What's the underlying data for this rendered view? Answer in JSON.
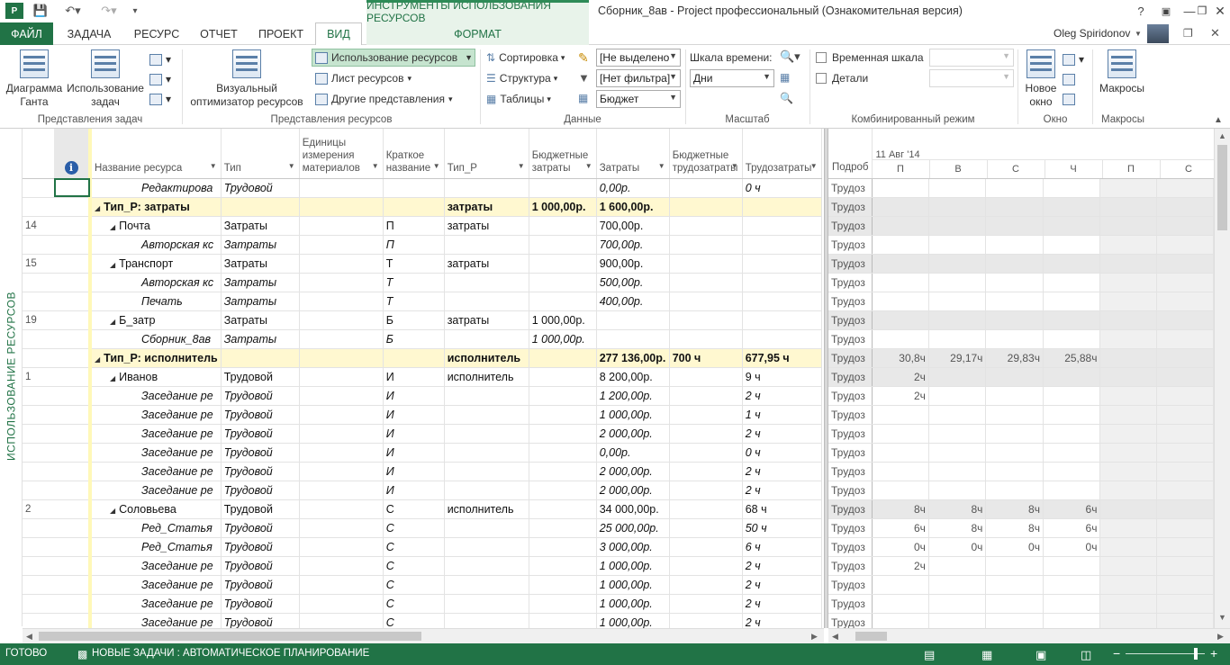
{
  "app": {
    "window_title": "Сборник_8ав - Project профессиональный (Ознакомительная версия)",
    "context_group": "ИНСТРУМЕНТЫ ИСПОЛЬЗОВАНИЯ РЕСУРСОВ",
    "user": "Oleg Spiridonov",
    "help": "?"
  },
  "tabs": [
    "ФАЙЛ",
    "ЗАДАЧА",
    "РЕСУРС",
    "ОТЧЕТ",
    "ПРОЕКТ",
    "ВИД",
    "ФОРМАТ"
  ],
  "ribbon": {
    "gantt": "Диаграмма Ганта",
    "task_usage": "Использование задач",
    "visual_optimizer": "Визуальный оптимизатор ресурсов",
    "resource_usage": "Использование ресурсов",
    "resource_sheet": "Лист ресурсов",
    "other_views": "Другие представления",
    "sort": "Сортировка",
    "outline": "Структура",
    "tables": "Таблицы",
    "highlight": "[Не выделено",
    "filter": "[Нет фильтра]",
    "group": "Бюджет",
    "timescale_label": "Шкала времени:",
    "timescale_value": "Дни",
    "timeline_chk": "Временная шкала",
    "details_chk": "Детали",
    "new_window": "Новое окно",
    "macros": "Макросы",
    "groups": {
      "task_views": "Представления задач",
      "resource_views": "Представления ресурсов",
      "data": "Данные",
      "zoom": "Масштаб",
      "split": "Комбинированный режим",
      "window": "Окно",
      "macros": "Макросы"
    }
  },
  "sidebar_label": "ИСПОЛЬЗОВАНИЕ РЕСУРСОВ",
  "columns": [
    "Название ресурса",
    "Тип",
    "Единицы измерения материалов",
    "Краткое название",
    "Тип_Р",
    "Бюджетные затраты",
    "Затраты",
    "Бюджетные трудозатраты",
    "Трудозатраты"
  ],
  "rows": [
    {
      "n": "",
      "name": "Редактирова",
      "lvl": 2,
      "type": "Трудовой",
      "unit": "",
      "short": "",
      "tp": "",
      "bc": "",
      "cost": "0,00р.",
      "bw": "",
      "work": "0 ч",
      "it": true,
      "grp": false
    },
    {
      "n": "",
      "name": "Тип_Р: затраты",
      "lvl": 0,
      "type": "",
      "unit": "",
      "short": "",
      "tp": "затраты",
      "bc": "1 000,00р.",
      "cost": "1 600,00р.",
      "bw": "",
      "work": "",
      "it": false,
      "grp": true
    },
    {
      "n": "14",
      "name": "Почта",
      "lvl": 1,
      "type": "Затраты",
      "unit": "",
      "short": "П",
      "tp": "затраты",
      "bc": "",
      "cost": "700,00р.",
      "bw": "",
      "work": "",
      "it": false,
      "grp": false
    },
    {
      "n": "",
      "name": "Авторская кс",
      "lvl": 2,
      "type": "Затраты",
      "unit": "",
      "short": "П",
      "tp": "",
      "bc": "",
      "cost": "700,00р.",
      "bw": "",
      "work": "",
      "it": true,
      "grp": false
    },
    {
      "n": "15",
      "name": "Транспорт",
      "lvl": 1,
      "type": "Затраты",
      "unit": "",
      "short": "Т",
      "tp": "затраты",
      "bc": "",
      "cost": "900,00р.",
      "bw": "",
      "work": "",
      "it": false,
      "grp": false
    },
    {
      "n": "",
      "name": "Авторская кс",
      "lvl": 2,
      "type": "Затраты",
      "unit": "",
      "short": "Т",
      "tp": "",
      "bc": "",
      "cost": "500,00р.",
      "bw": "",
      "work": "",
      "it": true,
      "grp": false
    },
    {
      "n": "",
      "name": "Печать",
      "lvl": 2,
      "type": "Затраты",
      "unit": "",
      "short": "Т",
      "tp": "",
      "bc": "",
      "cost": "400,00р.",
      "bw": "",
      "work": "",
      "it": true,
      "grp": false
    },
    {
      "n": "19",
      "name": "Б_затр",
      "lvl": 1,
      "type": "Затраты",
      "unit": "",
      "short": "Б",
      "tp": "затраты",
      "bc": "1 000,00р.",
      "cost": "",
      "bw": "",
      "work": "",
      "it": false,
      "grp": false
    },
    {
      "n": "",
      "name": "Сборник_8ав",
      "lvl": 2,
      "type": "Затраты",
      "unit": "",
      "short": "Б",
      "tp": "",
      "bc": "1 000,00р.",
      "cost": "",
      "bw": "",
      "work": "",
      "it": true,
      "grp": false
    },
    {
      "n": "",
      "name": "Тип_Р: исполнитель",
      "lvl": 0,
      "type": "",
      "unit": "",
      "short": "",
      "tp": "исполнитель",
      "bc": "",
      "cost": "277 136,00р.",
      "bw": "700 ч",
      "work": "677,95 ч",
      "it": false,
      "grp": true
    },
    {
      "n": "1",
      "name": "Иванов",
      "lvl": 1,
      "type": "Трудовой",
      "unit": "",
      "short": "И",
      "tp": "исполнитель",
      "bc": "",
      "cost": "8 200,00р.",
      "bw": "",
      "work": "9 ч",
      "it": false,
      "grp": false
    },
    {
      "n": "",
      "name": "Заседание ре",
      "lvl": 2,
      "type": "Трудовой",
      "unit": "",
      "short": "И",
      "tp": "",
      "bc": "",
      "cost": "1 200,00р.",
      "bw": "",
      "work": "2 ч",
      "it": true,
      "grp": false
    },
    {
      "n": "",
      "name": "Заседание ре",
      "lvl": 2,
      "type": "Трудовой",
      "unit": "",
      "short": "И",
      "tp": "",
      "bc": "",
      "cost": "1 000,00р.",
      "bw": "",
      "work": "1 ч",
      "it": true,
      "grp": false
    },
    {
      "n": "",
      "name": "Заседание ре",
      "lvl": 2,
      "type": "Трудовой",
      "unit": "",
      "short": "И",
      "tp": "",
      "bc": "",
      "cost": "2 000,00р.",
      "bw": "",
      "work": "2 ч",
      "it": true,
      "grp": false
    },
    {
      "n": "",
      "name": "Заседание ре",
      "lvl": 2,
      "type": "Трудовой",
      "unit": "",
      "short": "И",
      "tp": "",
      "bc": "",
      "cost": "0,00р.",
      "bw": "",
      "work": "0 ч",
      "it": true,
      "grp": false
    },
    {
      "n": "",
      "name": "Заседание ре",
      "lvl": 2,
      "type": "Трудовой",
      "unit": "",
      "short": "И",
      "tp": "",
      "bc": "",
      "cost": "2 000,00р.",
      "bw": "",
      "work": "2 ч",
      "it": true,
      "grp": false
    },
    {
      "n": "",
      "name": "Заседание ре",
      "lvl": 2,
      "type": "Трудовой",
      "unit": "",
      "short": "И",
      "tp": "",
      "bc": "",
      "cost": "2 000,00р.",
      "bw": "",
      "work": "2 ч",
      "it": true,
      "grp": false
    },
    {
      "n": "2",
      "name": "Соловьева",
      "lvl": 1,
      "type": "Трудовой",
      "unit": "",
      "short": "С",
      "tp": "исполнитель",
      "bc": "",
      "cost": "34 000,00р.",
      "bw": "",
      "work": "68 ч",
      "it": false,
      "grp": false
    },
    {
      "n": "",
      "name": "Ред_Статья",
      "lvl": 2,
      "type": "Трудовой",
      "unit": "",
      "short": "С",
      "tp": "",
      "bc": "",
      "cost": "25 000,00р.",
      "bw": "",
      "work": "50 ч",
      "it": true,
      "grp": false
    },
    {
      "n": "",
      "name": "Ред_Статья",
      "lvl": 2,
      "type": "Трудовой",
      "unit": "",
      "short": "С",
      "tp": "",
      "bc": "",
      "cost": "3 000,00р.",
      "bw": "",
      "work": "6 ч",
      "it": true,
      "grp": false
    },
    {
      "n": "",
      "name": "Заседание ре",
      "lvl": 2,
      "type": "Трудовой",
      "unit": "",
      "short": "С",
      "tp": "",
      "bc": "",
      "cost": "1 000,00р.",
      "bw": "",
      "work": "2 ч",
      "it": true,
      "grp": false
    },
    {
      "n": "",
      "name": "Заседание ре",
      "lvl": 2,
      "type": "Трудовой",
      "unit": "",
      "short": "С",
      "tp": "",
      "bc": "",
      "cost": "1 000,00р.",
      "bw": "",
      "work": "2 ч",
      "it": true,
      "grp": false
    },
    {
      "n": "",
      "name": "Заседание ре",
      "lvl": 2,
      "type": "Трудовой",
      "unit": "",
      "short": "С",
      "tp": "",
      "bc": "",
      "cost": "1 000,00р.",
      "bw": "",
      "work": "2 ч",
      "it": true,
      "grp": false
    },
    {
      "n": "",
      "name": "Заседание ре",
      "lvl": 2,
      "type": "Трудовой",
      "unit": "",
      "short": "С",
      "tp": "",
      "bc": "",
      "cost": "1 000,00р.",
      "bw": "",
      "work": "2 ч",
      "it": true,
      "grp": false
    }
  ],
  "timeline": {
    "details_header": "Подроб",
    "week_label": "11 Авг '14",
    "days": [
      "П",
      "В",
      "С",
      "Ч",
      "П",
      "С"
    ],
    "detail_label": "Трудоз",
    "rows": [
      {
        "v": [
          "",
          "",
          "",
          "",
          "",
          ""
        ],
        "shade": false
      },
      {
        "v": [
          "",
          "",
          "",
          "",
          "",
          ""
        ],
        "shade": true
      },
      {
        "v": [
          "",
          "",
          "",
          "",
          "",
          ""
        ],
        "shade": true
      },
      {
        "v": [
          "",
          "",
          "",
          "",
          "",
          ""
        ],
        "shade": false
      },
      {
        "v": [
          "",
          "",
          "",
          "",
          "",
          ""
        ],
        "shade": true
      },
      {
        "v": [
          "",
          "",
          "",
          "",
          "",
          ""
        ],
        "shade": false
      },
      {
        "v": [
          "",
          "",
          "",
          "",
          "",
          ""
        ],
        "shade": false
      },
      {
        "v": [
          "",
          "",
          "",
          "",
          "",
          ""
        ],
        "shade": true
      },
      {
        "v": [
          "",
          "",
          "",
          "",
          "",
          ""
        ],
        "shade": false
      },
      {
        "v": [
          "30,8ч",
          "29,17ч",
          "29,83ч",
          "25,88ч",
          "",
          ""
        ],
        "shade": true
      },
      {
        "v": [
          "2ч",
          "",
          "",
          "",
          "",
          ""
        ],
        "shade": true
      },
      {
        "v": [
          "2ч",
          "",
          "",
          "",
          "",
          ""
        ],
        "shade": false
      },
      {
        "v": [
          "",
          "",
          "",
          "",
          "",
          ""
        ],
        "shade": false
      },
      {
        "v": [
          "",
          "",
          "",
          "",
          "",
          ""
        ],
        "shade": false
      },
      {
        "v": [
          "",
          "",
          "",
          "",
          "",
          ""
        ],
        "shade": false
      },
      {
        "v": [
          "",
          "",
          "",
          "",
          "",
          ""
        ],
        "shade": false
      },
      {
        "v": [
          "",
          "",
          "",
          "",
          "",
          ""
        ],
        "shade": false
      },
      {
        "v": [
          "8ч",
          "8ч",
          "8ч",
          "6ч",
          "",
          ""
        ],
        "shade": true
      },
      {
        "v": [
          "6ч",
          "8ч",
          "8ч",
          "6ч",
          "",
          ""
        ],
        "shade": false
      },
      {
        "v": [
          "0ч",
          "0ч",
          "0ч",
          "0ч",
          "",
          ""
        ],
        "shade": false
      },
      {
        "v": [
          "2ч",
          "",
          "",
          "",
          "",
          ""
        ],
        "shade": false
      },
      {
        "v": [
          "",
          "",
          "",
          "",
          "",
          ""
        ],
        "shade": false
      },
      {
        "v": [
          "",
          "",
          "",
          "",
          "",
          ""
        ],
        "shade": false
      },
      {
        "v": [
          "",
          "",
          "",
          "",
          "",
          ""
        ],
        "shade": false
      }
    ]
  },
  "status": {
    "ready": "ГОТОВО",
    "mode": "НОВЫЕ ЗАДАЧИ : АВТОМАТИЧЕСКОЕ ПЛАНИРОВАНИЕ"
  },
  "colors": {
    "accent": "#217346",
    "group_row": "#fff8d0",
    "indicator": "#fff8b8"
  }
}
